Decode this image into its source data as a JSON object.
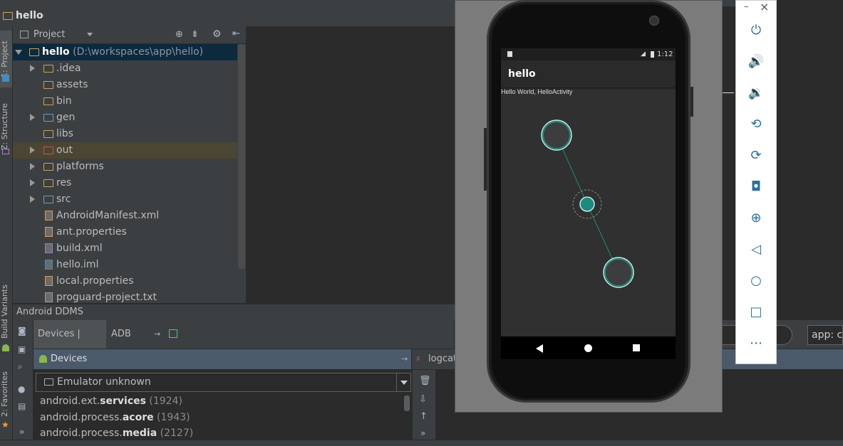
{
  "navbar": {
    "breadcrumb": "hello"
  },
  "left_tabs": {
    "project": "1: Project",
    "structure": "Z: Structure",
    "build_variants": "Build Variants",
    "favorites": "2: Favorites"
  },
  "project_panel": {
    "header": "Project",
    "tree": [
      {
        "name": "hello",
        "suffix": "(D:\\workspaces\\app\\hello)",
        "kind": "root",
        "expanded": true
      },
      {
        "name": ".idea",
        "kind": "folder",
        "expandable": true
      },
      {
        "name": "assets",
        "kind": "folder"
      },
      {
        "name": "bin",
        "kind": "folder"
      },
      {
        "name": "gen",
        "kind": "folder-blue",
        "expandable": true
      },
      {
        "name": "libs",
        "kind": "folder"
      },
      {
        "name": "out",
        "kind": "folder-red",
        "expandable": true
      },
      {
        "name": "platforms",
        "kind": "folder",
        "expandable": true
      },
      {
        "name": "res",
        "kind": "folder",
        "expandable": true
      },
      {
        "name": "src",
        "kind": "folder-blue",
        "expandable": true
      },
      {
        "name": "AndroidManifest.xml",
        "kind": "file"
      },
      {
        "name": "ant.properties",
        "kind": "file"
      },
      {
        "name": "build.xml",
        "kind": "file"
      },
      {
        "name": "hello.iml",
        "kind": "file"
      },
      {
        "name": "local.properties",
        "kind": "file"
      },
      {
        "name": "proguard-project.txt",
        "kind": "file"
      }
    ]
  },
  "ddms": {
    "title": "Android DDMS",
    "tabs": [
      "Devices | logcat",
      "ADB logs"
    ],
    "devices_header": "Devices",
    "logcat_header": "logcat",
    "device_selector": "Emulator unknown",
    "processes": [
      {
        "prefix": "android.ext.",
        "bold": "services",
        "pid": "(1924)"
      },
      {
        "prefix": "android.process.",
        "bold": "acore",
        "pid": "(1943)"
      },
      {
        "prefix": "android.process.",
        "bold": "media",
        "pid": "(2127)"
      }
    ],
    "filter_value": "app: co"
  },
  "emulator": {
    "status_time": "1:12",
    "app_title": "hello",
    "hello_text": "Hello World, HelloActivity",
    "accent": "#1d8a7e"
  },
  "emulator_controls": {
    "minimize": "–",
    "close": "×",
    "buttons": [
      "power-icon",
      "volume-up-icon",
      "volume-down-icon",
      "rotate-left-icon",
      "rotate-right-icon",
      "camera-icon",
      "zoom-icon",
      "back-icon",
      "home-icon",
      "overview-icon",
      "more-icon"
    ]
  }
}
